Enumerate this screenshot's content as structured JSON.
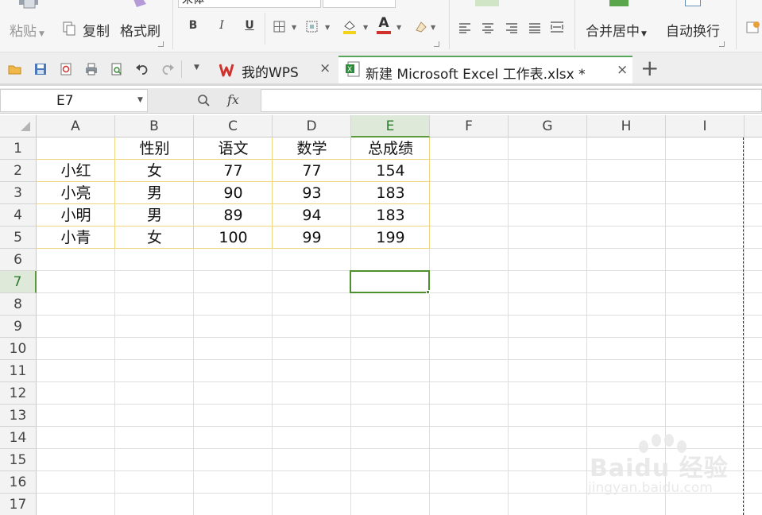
{
  "ribbon": {
    "paste_label": "粘贴",
    "copy_label": "复制",
    "format_painter_label": "格式刷",
    "font_name": "宋体",
    "merge_center_label": "合并居中",
    "wrap_text_label": "自动换行",
    "bold": "B",
    "italic": "I",
    "underline": "U",
    "font_color_glyph": "A"
  },
  "tabs": [
    {
      "label": "我的WPS",
      "close": "×"
    },
    {
      "label": "新建 Microsoft Excel 工作表.xlsx *",
      "close": "×"
    }
  ],
  "new_tab_glyph": "+",
  "formula_bar": {
    "name_box": "E7",
    "fx_label": "fx",
    "formula_value": ""
  },
  "sheet": {
    "columns": [
      "A",
      "B",
      "C",
      "D",
      "E",
      "F",
      "G",
      "H",
      "I"
    ],
    "rows": [
      "1",
      "2",
      "3",
      "4",
      "5",
      "6",
      "7",
      "8",
      "9",
      "10",
      "11",
      "12",
      "13",
      "14",
      "15",
      "16",
      "17"
    ],
    "active_column": "E",
    "active_row": "7",
    "header_row": [
      "",
      "性别",
      "语文",
      "数学",
      "总成绩"
    ],
    "data_rows": [
      [
        "小红",
        "女",
        "77",
        "77",
        "154"
      ],
      [
        "小亮",
        "男",
        "90",
        "93",
        "183"
      ],
      [
        "小明",
        "男",
        "89",
        "94",
        "183"
      ],
      [
        "小青",
        "女",
        "100",
        "99",
        "199"
      ]
    ]
  },
  "colors": {
    "accent_green": "#4e8f2e",
    "data_border": "#f0d580",
    "active_header_bg": "#dfe9d9",
    "wps_red": "#d0312d"
  },
  "watermark": {
    "main": "Baidu 经验",
    "sub": "jingyan.baidu.com"
  }
}
